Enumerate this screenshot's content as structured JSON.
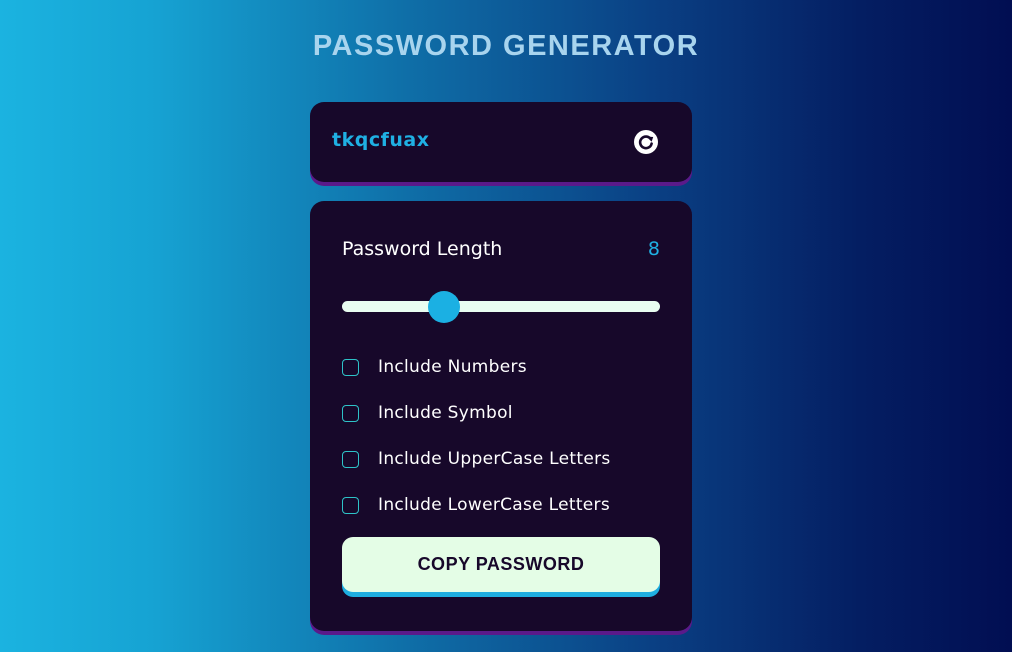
{
  "app": {
    "title": "PASSWORD GENERATOR"
  },
  "output": {
    "password": "tkqcfuax",
    "refresh_icon": "refresh-icon"
  },
  "settings": {
    "length_label": "Password Length",
    "length_value": "8",
    "slider": {
      "value": 8,
      "fraction": 0.32
    },
    "options": [
      {
        "label": "Include Numbers",
        "checked": false
      },
      {
        "label": "Include Symbol",
        "checked": false
      },
      {
        "label": "Include UpperCase Letters",
        "checked": false
      },
      {
        "label": "Include LowerCase Letters",
        "checked": false
      }
    ],
    "copy_label": "COPY PASSWORD"
  },
  "colors": {
    "card_bg": "#17082a",
    "accent": "#1fb0e3",
    "card_shadow": "#5a1a8a",
    "button_bg": "#e4fde6",
    "checkbox_border": "#2ec3c8"
  }
}
